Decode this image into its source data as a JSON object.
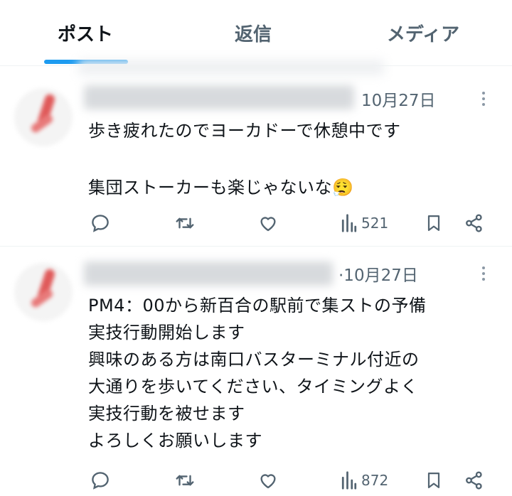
{
  "tabs": {
    "posts": "ポスト",
    "replies": "返信",
    "media": "メディア",
    "active": "posts"
  },
  "colors": {
    "accent": "#1d9bf0",
    "text": "#0f1419",
    "secondary": "#536471"
  },
  "posts": [
    {
      "date": "10月27日",
      "lines": [
        "歩き疲れたのでヨーカドーで休憩中です",
        "",
        "集団ストーカーも楽じゃないな😮‍💨"
      ],
      "views": "521",
      "icons": [
        "reply-icon",
        "repost-icon",
        "like-icon",
        "views-icon",
        "bookmark-icon",
        "share-icon"
      ]
    },
    {
      "date": "·10月27日",
      "lines": [
        "PM4：00から新百合の駅前で集ストの予備",
        "実技行動開始します",
        "興味のある方は南口バスターミナル付近の",
        "大通りを歩いてください、タイミングよく",
        "実技行動を被せます",
        "よろしくお願いします"
      ],
      "views": "872",
      "icons": [
        "reply-icon",
        "repost-icon",
        "like-icon",
        "views-icon",
        "bookmark-icon",
        "share-icon"
      ]
    }
  ]
}
